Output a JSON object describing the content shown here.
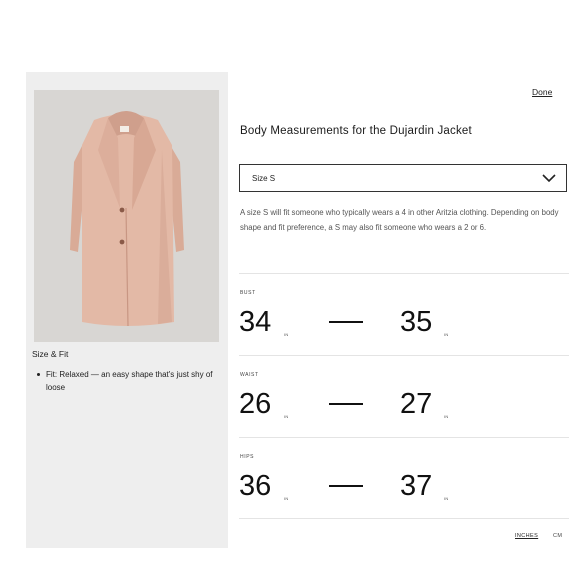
{
  "left_panel": {
    "image_alt": "Dujardin Jacket",
    "size_fit_title": "Size & Fit",
    "fit_items": [
      "Fit: Relaxed — an easy shape that's just shy of loose"
    ]
  },
  "modal": {
    "done_label": "Done",
    "title": "Body Measurements for the Dujardin Jacket",
    "size_select": {
      "value": "Size S",
      "icon": "chevron-down-icon"
    },
    "description": "A size S will fit someone who typically wears a 4 in other Aritzia clothing. Depending on body shape and fit preference, a S may also fit someone who wears a 2 or 6.",
    "measurements": [
      {
        "label": "BUST",
        "min": "34",
        "max": "35",
        "unit": "IN"
      },
      {
        "label": "WAIST",
        "min": "26",
        "max": "27",
        "unit": "IN"
      },
      {
        "label": "HIPS",
        "min": "36",
        "max": "37",
        "unit": "IN"
      }
    ],
    "units": {
      "inches": "INCHES",
      "cm": "CM",
      "selected": "INCHES"
    }
  },
  "colors": {
    "panel_bg": "#eeeeee",
    "coat": "#e3b9a6",
    "text": "#1a1a1a"
  }
}
